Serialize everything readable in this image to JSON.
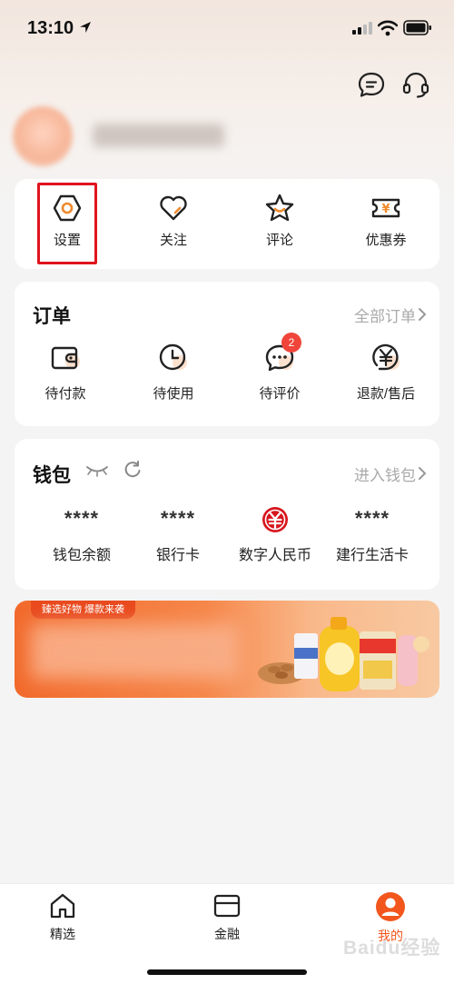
{
  "status_bar": {
    "time": "13:10"
  },
  "quick_actions": [
    {
      "label": "设置",
      "icon": "settings-hexagon-icon"
    },
    {
      "label": "关注",
      "icon": "heart-icon"
    },
    {
      "label": "评论",
      "icon": "star-icon"
    },
    {
      "label": "优惠券",
      "icon": "coupon-icon"
    }
  ],
  "orders": {
    "title": "订单",
    "all_link": "全部订单",
    "items": [
      {
        "label": "待付款",
        "icon": "wallet-icon"
      },
      {
        "label": "待使用",
        "icon": "clock-icon"
      },
      {
        "label": "待评价",
        "icon": "chat-bubble-icon",
        "badge": "2"
      },
      {
        "label": "退款/售后",
        "icon": "refund-yen-icon"
      }
    ]
  },
  "wallet": {
    "title": "钱包",
    "enter_link": "进入钱包",
    "items": [
      {
        "value": "****",
        "label": "钱包余额"
      },
      {
        "value": "****",
        "label": "银行卡"
      },
      {
        "value": "",
        "label": "数字人民币",
        "icon": "digital-rmb-icon"
      },
      {
        "value": "****",
        "label": "建行生活卡"
      }
    ]
  },
  "banner": {
    "tag": "臻选好物 爆款来袭"
  },
  "tabbar": {
    "items": [
      {
        "label": "精选",
        "icon": "home-icon",
        "active": false
      },
      {
        "label": "金融",
        "icon": "card-icon",
        "active": false
      },
      {
        "label": "我的",
        "icon": "user-icon",
        "active": true
      }
    ]
  },
  "colors": {
    "accent": "#f2561c",
    "highlight": "#e0141e",
    "badge": "#f0453a"
  },
  "watermark": "Baidu经验"
}
